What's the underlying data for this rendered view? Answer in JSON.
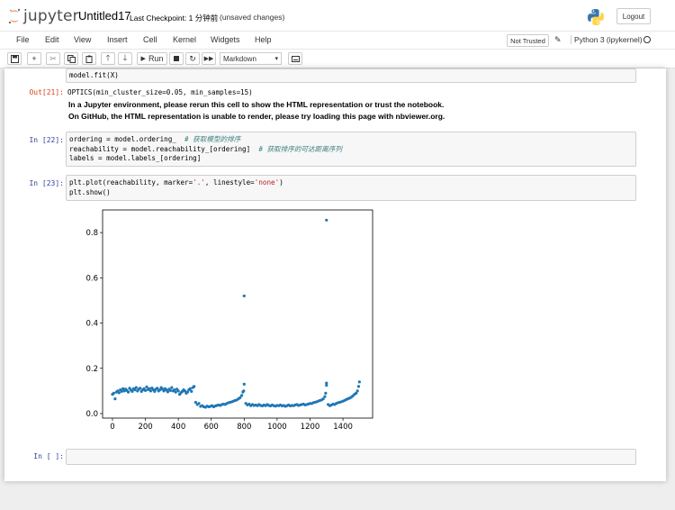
{
  "header": {
    "logo_text": "jupyter",
    "notebook_name": "Untitled17",
    "checkpoint": "Last Checkpoint: 1 分钟前",
    "unsaved": "(unsaved changes)",
    "logout": "Logout"
  },
  "menu": {
    "items": [
      "File",
      "Edit",
      "View",
      "Insert",
      "Cell",
      "Kernel",
      "Widgets",
      "Help"
    ],
    "not_trusted": "Not Trusted",
    "kernel": "Python 3 (ipykernel)"
  },
  "toolbar": {
    "run_label": "Run",
    "cell_type": "Markdown"
  },
  "cells": {
    "c20": {
      "code": "model.fit(X)"
    },
    "c21": {
      "prompt": "Out[21]:",
      "repr": "OPTICS(min_cluster_size=0.05, min_samples=15)",
      "warn1": "In a Jupyter environment, please rerun this cell to show the HTML representation or trust the notebook.",
      "warn2": "On GitHub, the HTML representation is unable to render, please try loading this page with nbviewer.org."
    },
    "c22": {
      "prompt": "In  [22]:",
      "l1_code": "ordering = model.ordering_  ",
      "l1_cmt": "# 获取模型的排序",
      "l2_code": "reachability = model.reachability_[ordering]  ",
      "l2_cmt": "# 获取排序的可达距离序列",
      "l3": "labels = model.labels_[ordering]"
    },
    "c23": {
      "prompt": "In  [23]:",
      "l1_a": "plt.plot(reachability, marker=",
      "l1_s1": "'.'",
      "l1_b": ", linestyle=",
      "l1_s2": "'none'",
      "l1_c": ")",
      "l2": "plt.show()"
    },
    "empty": {
      "prompt": "In  [ ]:"
    }
  },
  "chart_data": {
    "type": "scatter",
    "title": "",
    "xlabel": "",
    "ylabel": "",
    "xlim": [
      -60,
      1580
    ],
    "ylim": [
      -0.02,
      0.9
    ],
    "xticks": [
      0,
      200,
      400,
      600,
      800,
      1000,
      1200,
      1400
    ],
    "yticks": [
      0.0,
      0.2,
      0.4,
      0.6,
      0.8
    ],
    "xtick_labels": [
      "0",
      "200",
      "400",
      "600",
      "800",
      "1000",
      "1200",
      "1400"
    ],
    "ytick_labels": [
      "0.0",
      "0.2",
      "0.4",
      "0.6",
      "0.8"
    ],
    "marker_color": "#1f77b4",
    "points": [
      [
        0,
        0.085
      ],
      [
        8,
        0.09
      ],
      [
        16,
        0.065
      ],
      [
        24,
        0.095
      ],
      [
        32,
        0.1
      ],
      [
        40,
        0.092
      ],
      [
        48,
        0.105
      ],
      [
        56,
        0.098
      ],
      [
        64,
        0.11
      ],
      [
        72,
        0.1
      ],
      [
        80,
        0.108
      ],
      [
        88,
        0.102
      ],
      [
        96,
        0.095
      ],
      [
        104,
        0.112
      ],
      [
        112,
        0.104
      ],
      [
        120,
        0.098
      ],
      [
        128,
        0.11
      ],
      [
        136,
        0.105
      ],
      [
        144,
        0.115
      ],
      [
        152,
        0.1
      ],
      [
        160,
        0.108
      ],
      [
        168,
        0.112
      ],
      [
        176,
        0.098
      ],
      [
        184,
        0.105
      ],
      [
        192,
        0.11
      ],
      [
        200,
        0.102
      ],
      [
        208,
        0.118
      ],
      [
        216,
        0.106
      ],
      [
        224,
        0.11
      ],
      [
        232,
        0.1
      ],
      [
        240,
        0.113
      ],
      [
        248,
        0.105
      ],
      [
        256,
        0.098
      ],
      [
        264,
        0.108
      ],
      [
        272,
        0.112
      ],
      [
        280,
        0.1
      ],
      [
        288,
        0.105
      ],
      [
        296,
        0.115
      ],
      [
        304,
        0.108
      ],
      [
        312,
        0.1
      ],
      [
        320,
        0.11
      ],
      [
        328,
        0.104
      ],
      [
        336,
        0.096
      ],
      [
        344,
        0.108
      ],
      [
        352,
        0.102
      ],
      [
        360,
        0.115
      ],
      [
        368,
        0.1
      ],
      [
        376,
        0.105
      ],
      [
        384,
        0.095
      ],
      [
        392,
        0.108
      ],
      [
        400,
        0.1
      ],
      [
        408,
        0.085
      ],
      [
        416,
        0.092
      ],
      [
        424,
        0.098
      ],
      [
        432,
        0.105
      ],
      [
        440,
        0.1
      ],
      [
        448,
        0.09
      ],
      [
        456,
        0.095
      ],
      [
        464,
        0.105
      ],
      [
        472,
        0.11
      ],
      [
        480,
        0.098
      ],
      [
        488,
        0.115
      ],
      [
        496,
        0.12
      ],
      [
        505,
        0.05
      ],
      [
        515,
        0.04
      ],
      [
        525,
        0.045
      ],
      [
        535,
        0.032
      ],
      [
        545,
        0.035
      ],
      [
        555,
        0.03
      ],
      [
        565,
        0.028
      ],
      [
        575,
        0.033
      ],
      [
        585,
        0.03
      ],
      [
        595,
        0.032
      ],
      [
        605,
        0.035
      ],
      [
        615,
        0.03
      ],
      [
        625,
        0.034
      ],
      [
        635,
        0.036
      ],
      [
        645,
        0.038
      ],
      [
        655,
        0.036
      ],
      [
        665,
        0.04
      ],
      [
        675,
        0.042
      ],
      [
        685,
        0.04
      ],
      [
        695,
        0.045
      ],
      [
        705,
        0.048
      ],
      [
        715,
        0.05
      ],
      [
        725,
        0.052
      ],
      [
        735,
        0.055
      ],
      [
        745,
        0.058
      ],
      [
        755,
        0.06
      ],
      [
        765,
        0.065
      ],
      [
        775,
        0.07
      ],
      [
        785,
        0.08
      ],
      [
        792,
        0.095
      ],
      [
        797,
        0.1
      ],
      [
        800,
        0.13
      ],
      [
        800,
        0.52
      ],
      [
        810,
        0.045
      ],
      [
        820,
        0.038
      ],
      [
        830,
        0.042
      ],
      [
        840,
        0.035
      ],
      [
        850,
        0.04
      ],
      [
        860,
        0.036
      ],
      [
        870,
        0.038
      ],
      [
        880,
        0.035
      ],
      [
        890,
        0.04
      ],
      [
        900,
        0.036
      ],
      [
        910,
        0.034
      ],
      [
        920,
        0.038
      ],
      [
        930,
        0.035
      ],
      [
        940,
        0.04
      ],
      [
        950,
        0.036
      ],
      [
        960,
        0.034
      ],
      [
        970,
        0.038
      ],
      [
        980,
        0.035
      ],
      [
        990,
        0.033
      ],
      [
        1000,
        0.036
      ],
      [
        1010,
        0.035
      ],
      [
        1020,
        0.038
      ],
      [
        1030,
        0.034
      ],
      [
        1040,
        0.036
      ],
      [
        1050,
        0.032
      ],
      [
        1060,
        0.035
      ],
      [
        1070,
        0.038
      ],
      [
        1080,
        0.034
      ],
      [
        1090,
        0.036
      ],
      [
        1100,
        0.035
      ],
      [
        1110,
        0.038
      ],
      [
        1120,
        0.04
      ],
      [
        1130,
        0.036
      ],
      [
        1140,
        0.038
      ],
      [
        1150,
        0.04
      ],
      [
        1160,
        0.042
      ],
      [
        1170,
        0.038
      ],
      [
        1180,
        0.04
      ],
      [
        1190,
        0.042
      ],
      [
        1200,
        0.045
      ],
      [
        1210,
        0.044
      ],
      [
        1220,
        0.048
      ],
      [
        1230,
        0.05
      ],
      [
        1240,
        0.052
      ],
      [
        1250,
        0.055
      ],
      [
        1260,
        0.058
      ],
      [
        1270,
        0.06
      ],
      [
        1280,
        0.065
      ],
      [
        1290,
        0.075
      ],
      [
        1295,
        0.09
      ],
      [
        1300,
        0.125
      ],
      [
        1300,
        0.135
      ],
      [
        1300,
        0.855
      ],
      [
        1310,
        0.04
      ],
      [
        1320,
        0.035
      ],
      [
        1330,
        0.038
      ],
      [
        1340,
        0.042
      ],
      [
        1350,
        0.04
      ],
      [
        1360,
        0.045
      ],
      [
        1370,
        0.048
      ],
      [
        1380,
        0.05
      ],
      [
        1390,
        0.052
      ],
      [
        1400,
        0.055
      ],
      [
        1410,
        0.058
      ],
      [
        1420,
        0.062
      ],
      [
        1430,
        0.065
      ],
      [
        1440,
        0.068
      ],
      [
        1450,
        0.072
      ],
      [
        1460,
        0.078
      ],
      [
        1470,
        0.085
      ],
      [
        1480,
        0.09
      ],
      [
        1488,
        0.1
      ],
      [
        1495,
        0.12
      ],
      [
        1500,
        0.14
      ]
    ]
  }
}
